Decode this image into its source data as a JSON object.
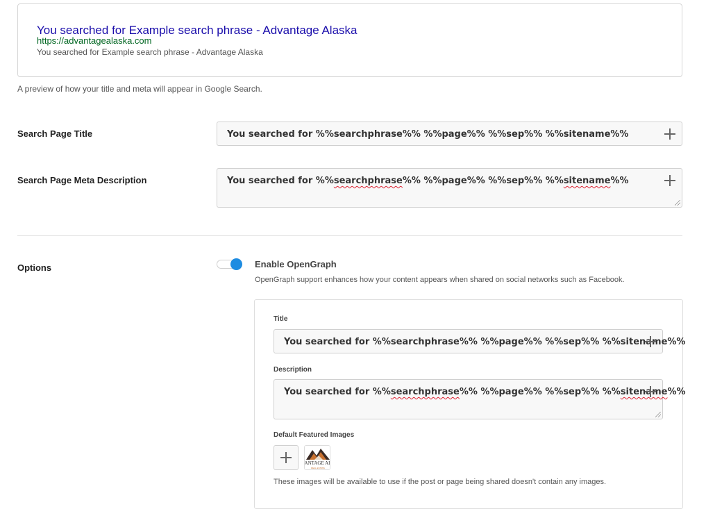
{
  "preview": {
    "title": "You searched for Example search phrase - Advantage Alaska",
    "url": "https://advantagealaska.com",
    "description": "You searched for Example search phrase - Advantage Alaska",
    "help": "A preview of how your title and meta will appear in Google Search."
  },
  "search_page_title": {
    "label": "Search Page Title",
    "value": "You searched for %%searchphrase%% %%page%% %%sep%% %%sitename%%"
  },
  "search_page_meta": {
    "label": "Search Page Meta Description",
    "value_parts": [
      "You searched for %%",
      "searchphrase",
      "%% %%page%% %%sep%% %%",
      "sitename",
      "%%"
    ]
  },
  "options": {
    "label": "Options",
    "opengraph": {
      "enabled": true,
      "label": "Enable OpenGraph",
      "help": "OpenGraph support enhances how your content appears when shared on social networks such as Facebook.",
      "title_label": "Title",
      "title_value": "You searched for %%searchphrase%% %%page%% %%sep%% %%sitename%%",
      "description_label": "Description",
      "description_parts": [
        "You searched for %%",
        "searchphrase",
        "%% %%page%% %%sep%% %%",
        "sitename",
        "%%"
      ],
      "images_label": "Default Featured Images",
      "images_help": "These images will be available to use if the post or page being shared doesn't contain any images.",
      "thumb_logo_text": "ANTAGE AL",
      "thumb_sub_text": "REAL ESTATE"
    }
  },
  "colors": {
    "preview_title": "#1a0dab",
    "preview_url": "#006621",
    "toggle_on": "#1e8ce1"
  }
}
